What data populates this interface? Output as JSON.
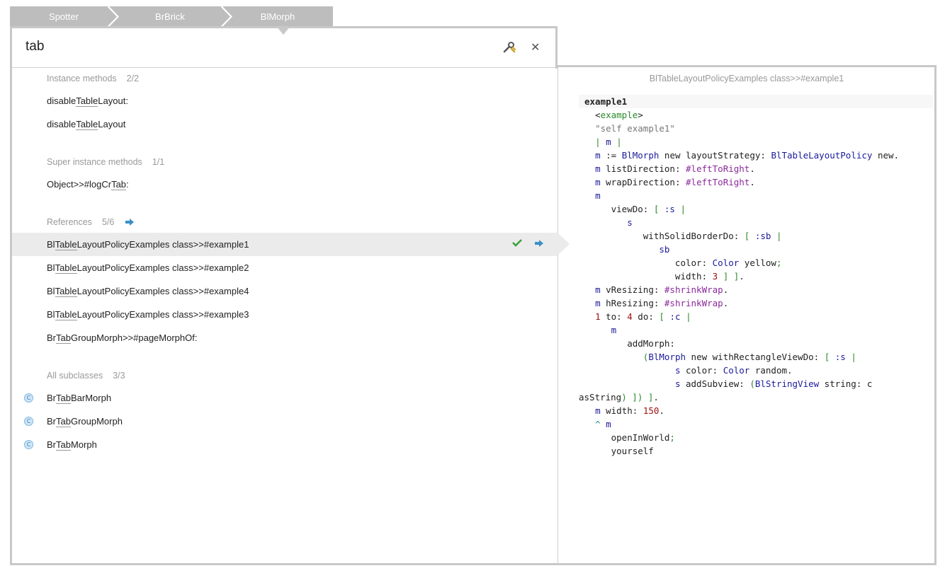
{
  "breadcrumb": [
    "Spotter",
    "BrBrick",
    "BlMorph"
  ],
  "search": {
    "query": "tab"
  },
  "categories": {
    "instance_methods": {
      "label": "Instance methods",
      "count": "2/2",
      "items": [
        {
          "pre": "disable",
          "match": "Table",
          "post": "Layout:"
        },
        {
          "pre": "disable",
          "match": "Table",
          "post": "Layout"
        }
      ]
    },
    "super_instance_methods": {
      "label": "Super instance methods",
      "count": "1/1",
      "items": [
        {
          "pre": "Object>>#logCr",
          "match": "Tab",
          "post": ":"
        }
      ]
    },
    "references": {
      "label": "References",
      "count": "5/6",
      "items": [
        {
          "pre": "Bl",
          "match": "Table",
          "post": "LayoutPolicyExamples class>>#example1"
        },
        {
          "pre": "Bl",
          "match": "Table",
          "post": "LayoutPolicyExamples class>>#example2"
        },
        {
          "pre": "Bl",
          "match": "Table",
          "post": "LayoutPolicyExamples class>>#example4"
        },
        {
          "pre": "Bl",
          "match": "Table",
          "post": "LayoutPolicyExamples class>>#example3"
        },
        {
          "pre": "Br",
          "match": "Tab",
          "post": "GroupMorph>>#pageMorphOf:"
        }
      ]
    },
    "all_subclasses": {
      "label": "All subclasses",
      "count": "3/3",
      "items": [
        {
          "pre": "Br",
          "match": "Tab",
          "post": "BarMorph"
        },
        {
          "pre": "Br",
          "match": "Tab",
          "post": "GroupMorph"
        },
        {
          "pre": "Br",
          "match": "Tab",
          "post": "Morph"
        }
      ]
    }
  },
  "class_icon_letter": "C",
  "preview": {
    "title": "BlTableLayoutPolicyExamples class>>#example1",
    "code_lines": [
      "example1",
      "  <example>",
      "  \"self example1\"",
      "  | m |",
      "  m := BlMorph new layoutStrategy: BlTableLayoutPolicy new.",
      "  m listDirection: #leftToRight.",
      "  m wrapDirection: #leftToRight.",
      "  m",
      "     viewDo: [ :s |",
      "        s",
      "           withSolidBorderDo: [ :sb |",
      "              sb",
      "                 color: Color yellow;",
      "                 width: 3 ] ].",
      "  m vResizing: #shrinkWrap.",
      "  m hResizing: #shrinkWrap.",
      "  1 to: 4 do: [ :c |",
      "     m",
      "        addMorph:",
      "           (BlMorph new withRectangleViewDo: [ :s |",
      "                 s color: Color random.",
      "                 s addSubview: (BlStringView string: c",
      "asString) ]) ].",
      "  m width: 150.",
      "  ^ m",
      "     openInWorld;",
      "     yourself"
    ]
  },
  "colors": {
    "selected_row": "#ebebeb",
    "frame": "#c8c8c8",
    "arrow": "#3b8fc7",
    "check": "#3aa03a"
  }
}
